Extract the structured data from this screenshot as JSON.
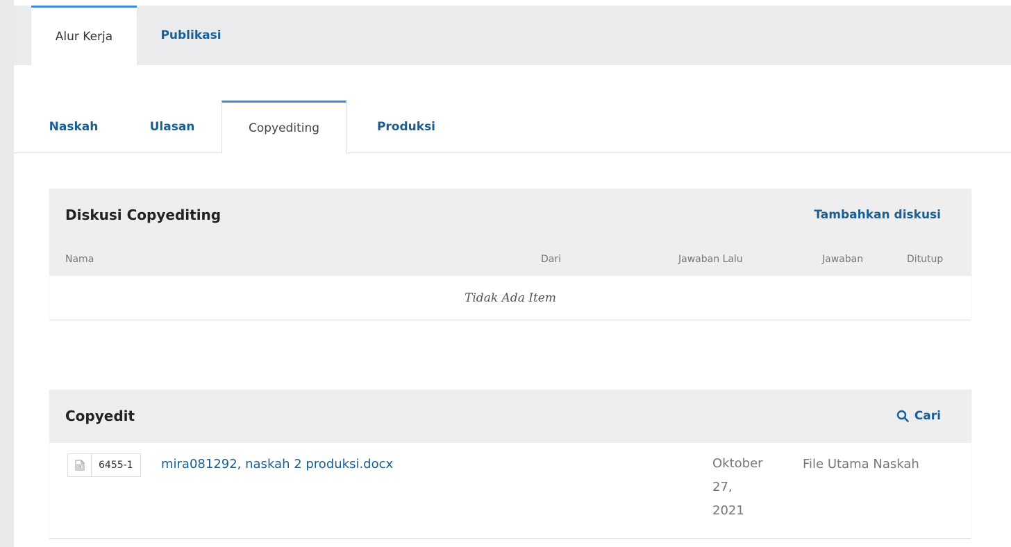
{
  "top_tabs": [
    {
      "label": "Alur Kerja",
      "active": true
    },
    {
      "label": "Publikasi",
      "active": false
    }
  ],
  "stage_tabs": [
    {
      "label": "Naskah",
      "active": false
    },
    {
      "label": "Ulasan",
      "active": false
    },
    {
      "label": "Copyediting",
      "active": true
    },
    {
      "label": "Produksi",
      "active": false
    }
  ],
  "discussion": {
    "title": "Diskusi Copyediting",
    "action": "Tambahkan diskusi",
    "columns": [
      "Nama",
      "Dari",
      "Jawaban Lalu",
      "Jawaban",
      "Ditutup"
    ],
    "empty_text": "Tidak Ada Item"
  },
  "copyedit": {
    "title": "Copyedit",
    "action": "Cari",
    "action_icon": "search-icon",
    "files": [
      {
        "icon": "word-file-icon",
        "id": "6455-1",
        "name": "mira081292, naskah 2 produksi.docx",
        "date_line1": "Oktober",
        "date_line2": "27,",
        "date_line3": "2021",
        "type": "File Utama Naskah"
      }
    ]
  },
  "colors": {
    "link": "#1a5f93",
    "accent": "#3c8ad8",
    "header_bg": "#eeeeee"
  }
}
